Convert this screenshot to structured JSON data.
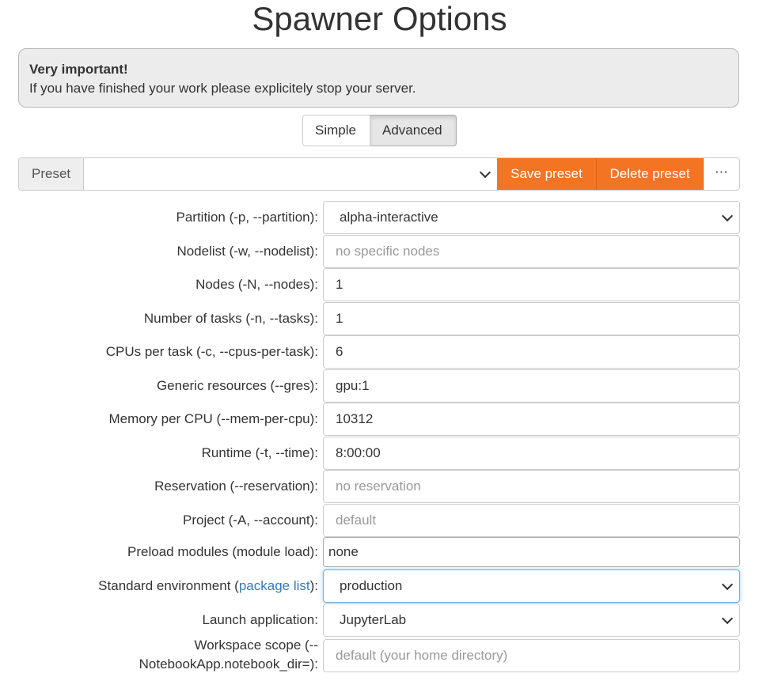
{
  "page": {
    "title": "Spawner Options"
  },
  "alert": {
    "heading": "Very important!",
    "text": "If you have finished your work please explicitely stop your server."
  },
  "mode_toggle": {
    "simple": "Simple",
    "advanced": "Advanced",
    "active": "Advanced"
  },
  "preset": {
    "label": "Preset",
    "selected": "",
    "save_label": "Save preset",
    "delete_label": "Delete preset",
    "more_label": "⋯"
  },
  "form": {
    "partition": {
      "label": "Partition (-p, --partition):",
      "value": "alpha-interactive"
    },
    "nodelist": {
      "label": "Nodelist (-w, --nodelist):",
      "placeholder": "no specific nodes",
      "value": ""
    },
    "nodes": {
      "label": "Nodes (-N, --nodes):",
      "value": "1"
    },
    "tasks": {
      "label": "Number of tasks (-n, --tasks):",
      "value": "1"
    },
    "cpus": {
      "label": "CPUs per task (-c, --cpus-per-task):",
      "value": "6"
    },
    "gres": {
      "label": "Generic resources (--gres):",
      "value": "gpu:1"
    },
    "mem": {
      "label": "Memory per CPU (--mem-per-cpu):",
      "value": "10312"
    },
    "runtime": {
      "label": "Runtime (-t, --time):",
      "value": "8:00:00"
    },
    "reservation": {
      "label": "Reservation (--reservation):",
      "placeholder": "no reservation",
      "value": ""
    },
    "project": {
      "label": "Project (-A, --account):",
      "placeholder": "default",
      "value": ""
    },
    "modules": {
      "label": "Preload modules (module load):",
      "value": "none"
    },
    "environment": {
      "label_prefix": "Standard environment (",
      "link": "package list",
      "label_suffix": "):",
      "value": "production"
    },
    "launch": {
      "label": "Launch application:",
      "value": "JupyterLab"
    },
    "workspace": {
      "label_line1": "Workspace scope (--",
      "label_line2": "NotebookApp.notebook_dir=):",
      "placeholder": "default (your home directory)",
      "value": ""
    }
  },
  "colors": {
    "accent": "#f37524",
    "link": "#337ab7",
    "focus": "#66afe9"
  }
}
